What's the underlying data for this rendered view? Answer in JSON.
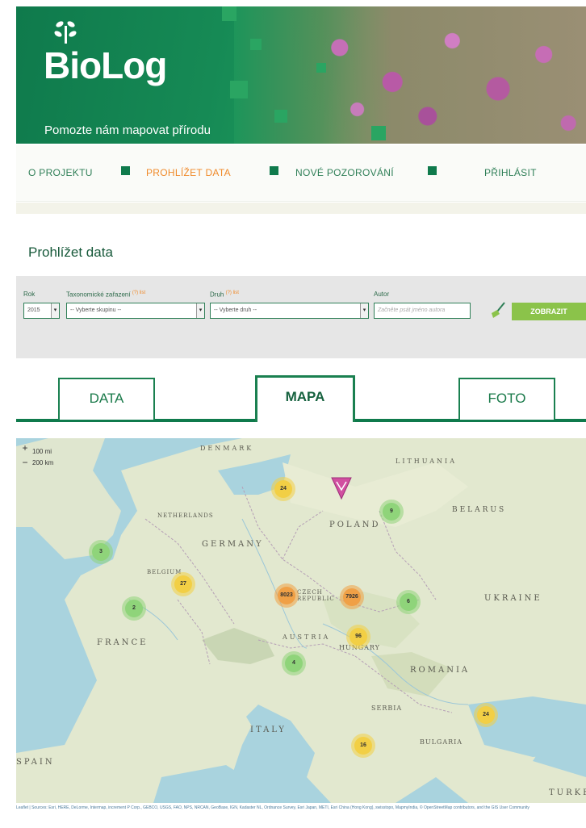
{
  "header": {
    "logo": "BioLog",
    "tagline": "Pomozte nám mapovat přírodu"
  },
  "nav": {
    "items": [
      {
        "label": "O PROJEKTU"
      },
      {
        "label": "PROHLÍŽET DATA",
        "active": true
      },
      {
        "label": "NOVÉ POZOROVÁNÍ"
      },
      {
        "label": "PŘIHLÁSIT"
      }
    ]
  },
  "page": {
    "title": "Prohlížet data"
  },
  "filters": {
    "year": {
      "label": "Rok",
      "value": "2015"
    },
    "taxonomy": {
      "label": "Taxonomické zařazení",
      "hint": "(?) list",
      "value": "-- Vyberte skupinu --"
    },
    "species": {
      "label": "Druh",
      "hint": "(?) list",
      "value": "-- Vyberte druh --"
    },
    "actor": {
      "label": "Autor",
      "placeholder": "Začněte psát jméno autora"
    },
    "show_label": "ZOBRAZIT"
  },
  "tabs": [
    {
      "label": "DATA"
    },
    {
      "label": "MAPA",
      "active": true
    },
    {
      "label": "FOTO"
    }
  ],
  "map": {
    "zoom_in": "+",
    "zoom_out": "−",
    "scale_top": "100 mi",
    "scale_bottom": "200 km",
    "countries": [
      "DENMARK",
      "LITHUANIA",
      "BELARUS",
      "POLAND",
      "NETHERLANDS",
      "GERMANY",
      "BELGIUM",
      "CZECH REPUBLIC",
      "UKRAINE",
      "FRANCE",
      "AUSTRIA",
      "HUNGARY",
      "ROMANIA",
      "ITALY",
      "SERBIA",
      "BULGARIA",
      "SPAIN",
      "TURKEY"
    ],
    "clusters": [
      "24",
      "9",
      "3",
      "27",
      "2",
      "8023",
      "7926",
      "6",
      "96",
      "4",
      "24",
      "16"
    ],
    "attribution": "Leaflet | Sources: Esri, HERE, DeLorme, Intermap, increment P Corp., GEBCO, USGS, FAO, NPS, NRCAN, GeoBase, IGN, Kadaster NL, Ordnance Survey, Esri Japan, METI, Esri China (Hong Kong), swisstopo, MapmyIndia, © OpenStreetMap contributors, and the GIS User Community"
  }
}
